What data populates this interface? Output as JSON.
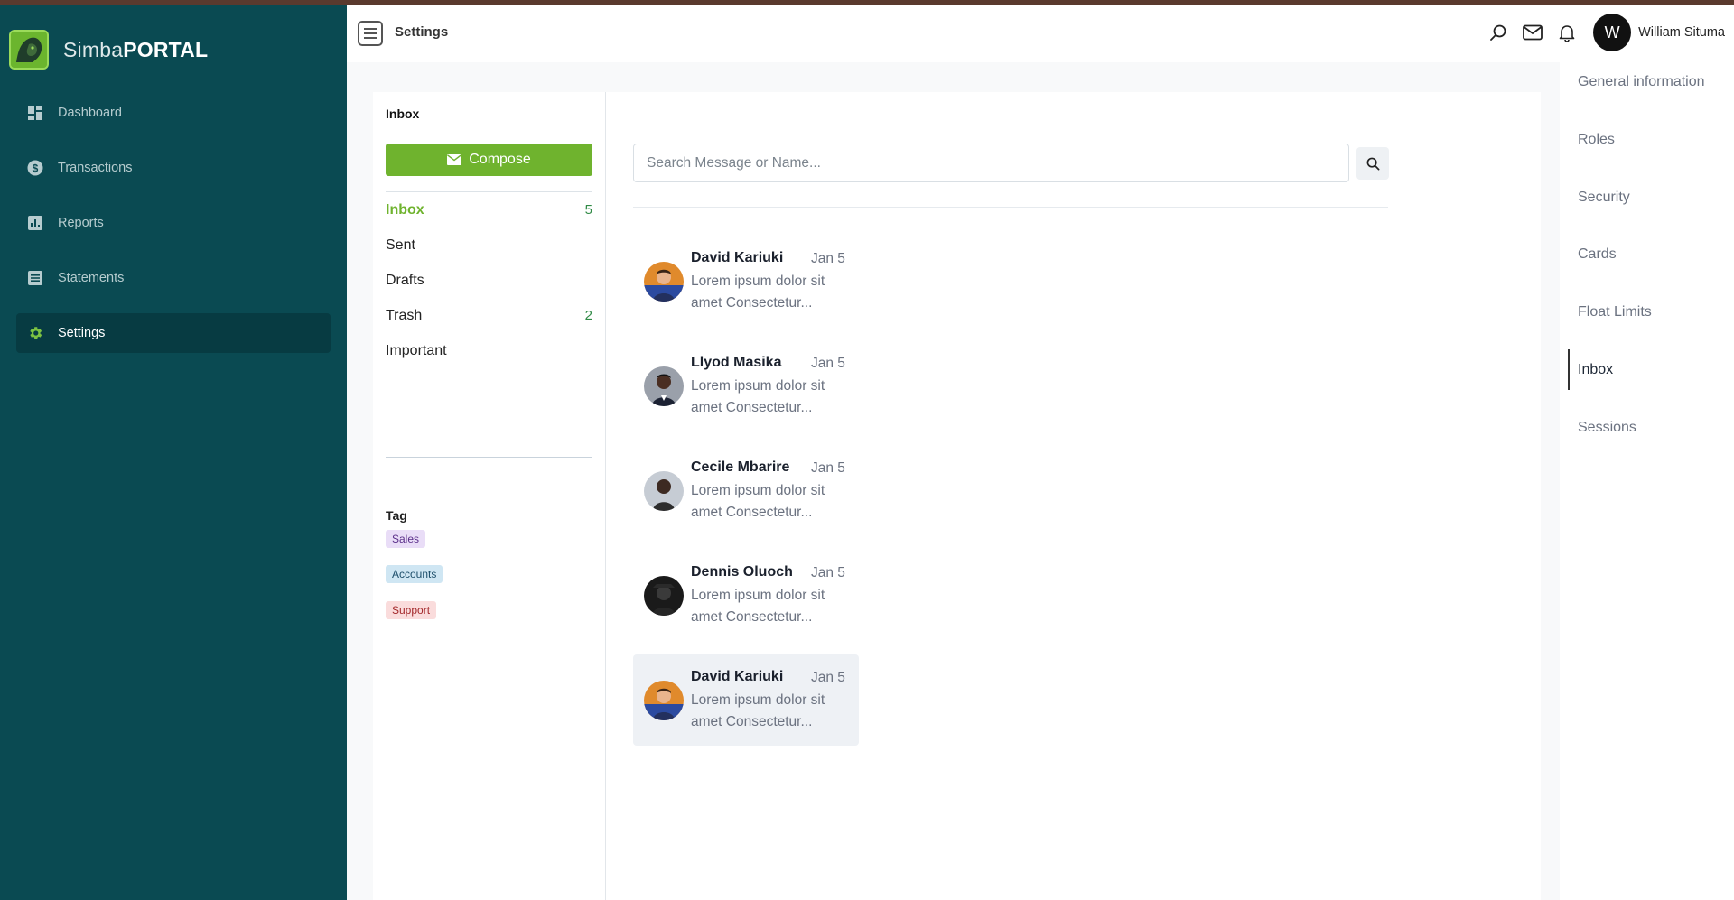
{
  "app": {
    "brand_prefix": "Simba",
    "brand_suffix": "PORTAL"
  },
  "sidebar": {
    "items": [
      {
        "label": "Dashboard",
        "icon": "dashboard-icon"
      },
      {
        "label": "Transactions",
        "icon": "dollar-icon"
      },
      {
        "label": "Reports",
        "icon": "bar-chart-icon"
      },
      {
        "label": "Statements",
        "icon": "document-icon"
      },
      {
        "label": "Settings",
        "icon": "gear-icon",
        "active": true
      }
    ]
  },
  "topbar": {
    "title": "Settings",
    "user_initial": "W",
    "user_name": "William Situma"
  },
  "mailbox": {
    "title": "Inbox",
    "compose_label": "Compose",
    "folders": [
      {
        "label": "Inbox",
        "count": "5",
        "active": true
      },
      {
        "label": "Sent",
        "count": ""
      },
      {
        "label": "Drafts",
        "count": ""
      },
      {
        "label": "Trash",
        "count": "2"
      },
      {
        "label": "Important",
        "count": ""
      }
    ],
    "tag_title": "Tag",
    "tags": [
      "Sales",
      "Accounts",
      "Support"
    ]
  },
  "search": {
    "placeholder": "Search Message or Name..."
  },
  "messages": [
    {
      "name": "David Kariuki",
      "date": "Jan 5",
      "preview": "Lorem ipsum dolor sit amet Consectetur..."
    },
    {
      "name": "Llyod Masika",
      "date": "Jan 5",
      "preview": "Lorem ipsum dolor sit amet Consectetur..."
    },
    {
      "name": "Cecile Mbarire",
      "date": "Jan 5",
      "preview": "Lorem ipsum dolor sit amet Consectetur..."
    },
    {
      "name": "Dennis Oluoch",
      "date": "Jan 5",
      "preview": "Lorem ipsum dolor sit amet Consectetur..."
    },
    {
      "name": "David Kariuki",
      "date": "Jan 5",
      "preview": "Lorem ipsum dolor sit amet Consectetur...",
      "selected": true
    }
  ],
  "settings_nav": {
    "items": [
      "General information",
      "Roles",
      "Security",
      "Cards",
      "Float Limits",
      "Inbox",
      "Sessions"
    ],
    "active": "Inbox"
  },
  "colors": {
    "sidebar_bg": "#0a4a52",
    "accent_green": "#6fb32e",
    "count_green": "#2f8a45"
  }
}
